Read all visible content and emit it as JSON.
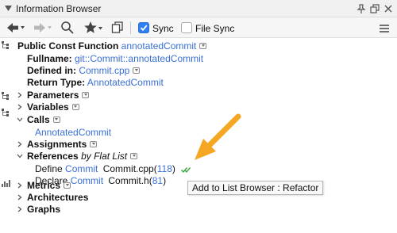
{
  "window": {
    "title": "Information Browser"
  },
  "toolbar": {
    "sync_label": "Sync",
    "sync_checked": true,
    "file_sync_label": "File Sync",
    "file_sync_checked": false
  },
  "tree": {
    "function_kind": "Public Const Function",
    "function_name": "annotatedCommit",
    "fullname_label": "Fullname:",
    "fullname_ns": "git",
    "fullname_sep1": "::",
    "fullname_class": "Commit",
    "fullname_sep2": "::",
    "fullname_member": "annotatedCommit",
    "defined_in_label": "Defined in:",
    "defined_in_value": "Commit.cpp",
    "return_type_label": "Return Type:",
    "return_type_value": "AnnotatedCommit",
    "parameters": "Parameters",
    "variables": "Variables",
    "calls": "Calls",
    "calls_child": "AnnotatedCommit",
    "assignments": "Assignments",
    "references": "References",
    "references_mode": "by Flat List",
    "ref1_kind": "Define",
    "ref1_symbol": "Commit",
    "ref1_file": "Commit.cpp(",
    "ref1_line": "118",
    "ref1_close": ")",
    "ref2_kind": "Declare",
    "ref2_symbol": "Commit",
    "ref2_file": "Commit.h(",
    "ref2_line": "81",
    "ref2_close": ")",
    "metrics": "Metrics",
    "architectures": "Architectures",
    "graphs": "Graphs"
  },
  "tooltip": {
    "text": "Add to List Browser : Refactor"
  },
  "colors": {
    "link": "#3a6fd6",
    "checkbox_accent": "#2f7ff0",
    "annotation_arrow": "#f5a623",
    "checkmark": "#3aa63a"
  },
  "icons": [
    "collapse-triangle-icon",
    "pin-icon",
    "undock-icon",
    "close-icon",
    "back-icon",
    "forward-icon",
    "search-icon",
    "bookmark-star-icon",
    "copy-icon",
    "menu-icon",
    "tree-structure-icon",
    "metrics-icon",
    "dropdown-badge-icon",
    "checkmark-icon"
  ]
}
